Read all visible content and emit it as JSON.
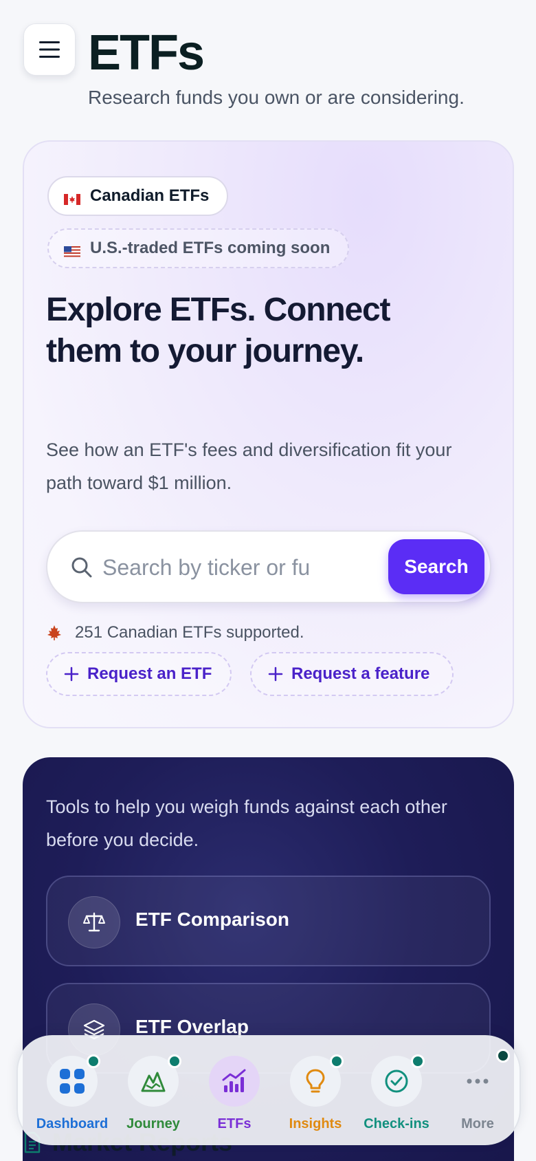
{
  "header": {
    "title": "ETFs",
    "subtitle": "Research funds you own or are considering."
  },
  "hero": {
    "market_pills": [
      {
        "label": "Canadian ETFs",
        "flag": "canada-flag-icon"
      },
      {
        "label": "U.S.-traded ETFs coming soon",
        "flag": "us-flag-icon"
      }
    ],
    "heading": "Explore ETFs. Connect them to your journey.",
    "description": "See how an ETF's fees and diversification fit your path toward $1 million.",
    "search": {
      "placeholder": "Search by ticker or fund name",
      "button_label": "Search"
    },
    "supported_text": "251 Canadian ETFs supported.",
    "request_etf_label": "Request an ETF",
    "request_feature_label": "Request a feature"
  },
  "tools": {
    "description": "Tools to help you weigh funds against each other before you decide.",
    "items": [
      {
        "label": "ETF Comparison",
        "icon": "scale-icon"
      },
      {
        "label": "ETF Overlap",
        "icon": "layers-icon"
      }
    ]
  },
  "market_reports": {
    "label": "Market Reports"
  },
  "bottom_nav": {
    "items": [
      {
        "label": "Dashboard",
        "color": "#1d6fd6",
        "badge": true
      },
      {
        "label": "Journey",
        "color": "#2f8a3a",
        "badge": true
      },
      {
        "label": "ETFs",
        "color": "#7a2ed6",
        "badge": false,
        "active": true
      },
      {
        "label": "Insights",
        "color": "#e08a10",
        "badge": true
      },
      {
        "label": "Check-ins",
        "color": "#11907e",
        "badge": true
      },
      {
        "label": "More",
        "color": "#7c8590",
        "badge": true
      }
    ]
  },
  "colors": {
    "accent": "#5b2df5",
    "tools_bg": "#1e1d58",
    "badge": "#0e7d6e"
  }
}
